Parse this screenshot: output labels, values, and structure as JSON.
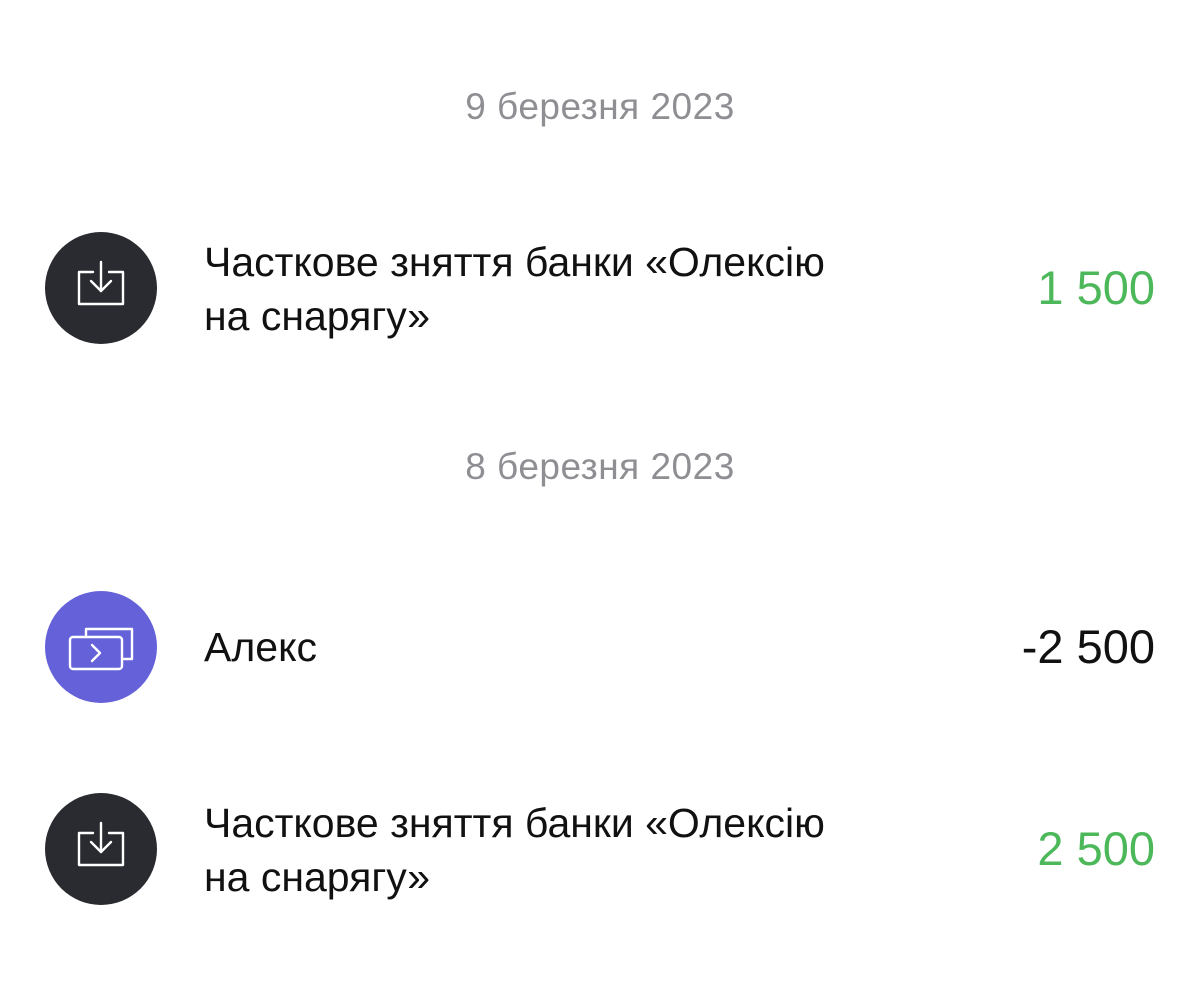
{
  "groups": [
    {
      "date": "9 березня 2023",
      "transactions": [
        {
          "icon": "withdraw-icon",
          "icon_color": "#2a2b30",
          "title_line1": "Часткове зняття банки «Олексію",
          "title_line2": "на снарягу»",
          "amount": "1 500",
          "amount_color": "#4cb85a"
        }
      ]
    },
    {
      "date": "8 березня 2023",
      "transactions": [
        {
          "icon": "transfer-icon",
          "icon_color": "#6562d9",
          "title_line1": "Алекс",
          "amount": "-2 500",
          "amount_color": "#111111"
        },
        {
          "icon": "withdraw-icon",
          "icon_color": "#2a2b30",
          "title_line1": "Часткове зняття банки «Олексію",
          "title_line2": "на снарягу»",
          "amount": "2 500",
          "amount_color": "#4cb85a"
        }
      ]
    }
  ]
}
